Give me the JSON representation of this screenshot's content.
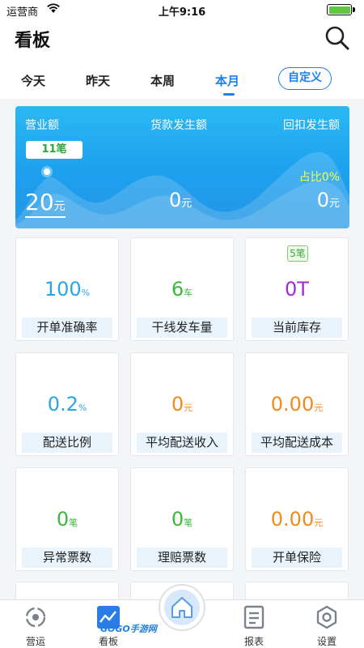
{
  "status_bar": {
    "carrier": "运营商",
    "time": "上午9:16",
    "wifi_icon": "wifi-icon",
    "battery_icon": "battery-icon",
    "battery_level": 1.0
  },
  "header": {
    "title": "看板",
    "search_icon": "search-icon"
  },
  "tabs": [
    {
      "label": "今天",
      "active": false
    },
    {
      "label": "昨天",
      "active": false
    },
    {
      "label": "本周",
      "active": false
    },
    {
      "label": "本月",
      "active": true
    }
  ],
  "custom_button": "自定义",
  "summary": {
    "revenue": {
      "label": "营业额",
      "count_badge": "11笔",
      "value": "20",
      "unit": "元"
    },
    "payment": {
      "label": "货款发生额",
      "value": "0",
      "unit": "元"
    },
    "rebate": {
      "label": "回扣发生额",
      "ratio": "占比0%",
      "value": "0",
      "unit": "元"
    }
  },
  "cards": [
    {
      "value": "100",
      "unit": "%",
      "label": "开单准确率",
      "color": "#2aa6e8"
    },
    {
      "value": "6",
      "unit": "车",
      "label": "干线发车量",
      "color": "#3bb83a"
    },
    {
      "value": "0T",
      "unit": "",
      "label": "当前库存",
      "badge": "5笔",
      "color": "#a229d6"
    },
    {
      "value": "0.2",
      "unit": "%",
      "label": "配送比例",
      "color": "#2aa6e8"
    },
    {
      "value": "0",
      "unit": "元",
      "label": "平均配送收入",
      "color": "#f08a1e"
    },
    {
      "value": "0.00",
      "unit": "元",
      "label": "平均配送成本",
      "color": "#f08a1e"
    },
    {
      "value": "0",
      "unit": "笔",
      "label": "异常票数",
      "color": "#3bb83a"
    },
    {
      "value": "0",
      "unit": "笔",
      "label": "理赔票数",
      "color": "#3bb83a"
    },
    {
      "value": "0.00",
      "unit": "元",
      "label": "开单保险",
      "color": "#f08a1e"
    }
  ],
  "tabbar": {
    "items": [
      {
        "label": "营运",
        "icon": "operations-icon"
      },
      {
        "label": "看板",
        "icon": "dashboard-chart-icon",
        "active": true
      },
      {
        "label": "报表",
        "icon": "report-icon"
      },
      {
        "label": "设置",
        "icon": "settings-gear-icon"
      }
    ],
    "home_icon": "home-icon"
  },
  "watermark": "GOGO手游网"
}
